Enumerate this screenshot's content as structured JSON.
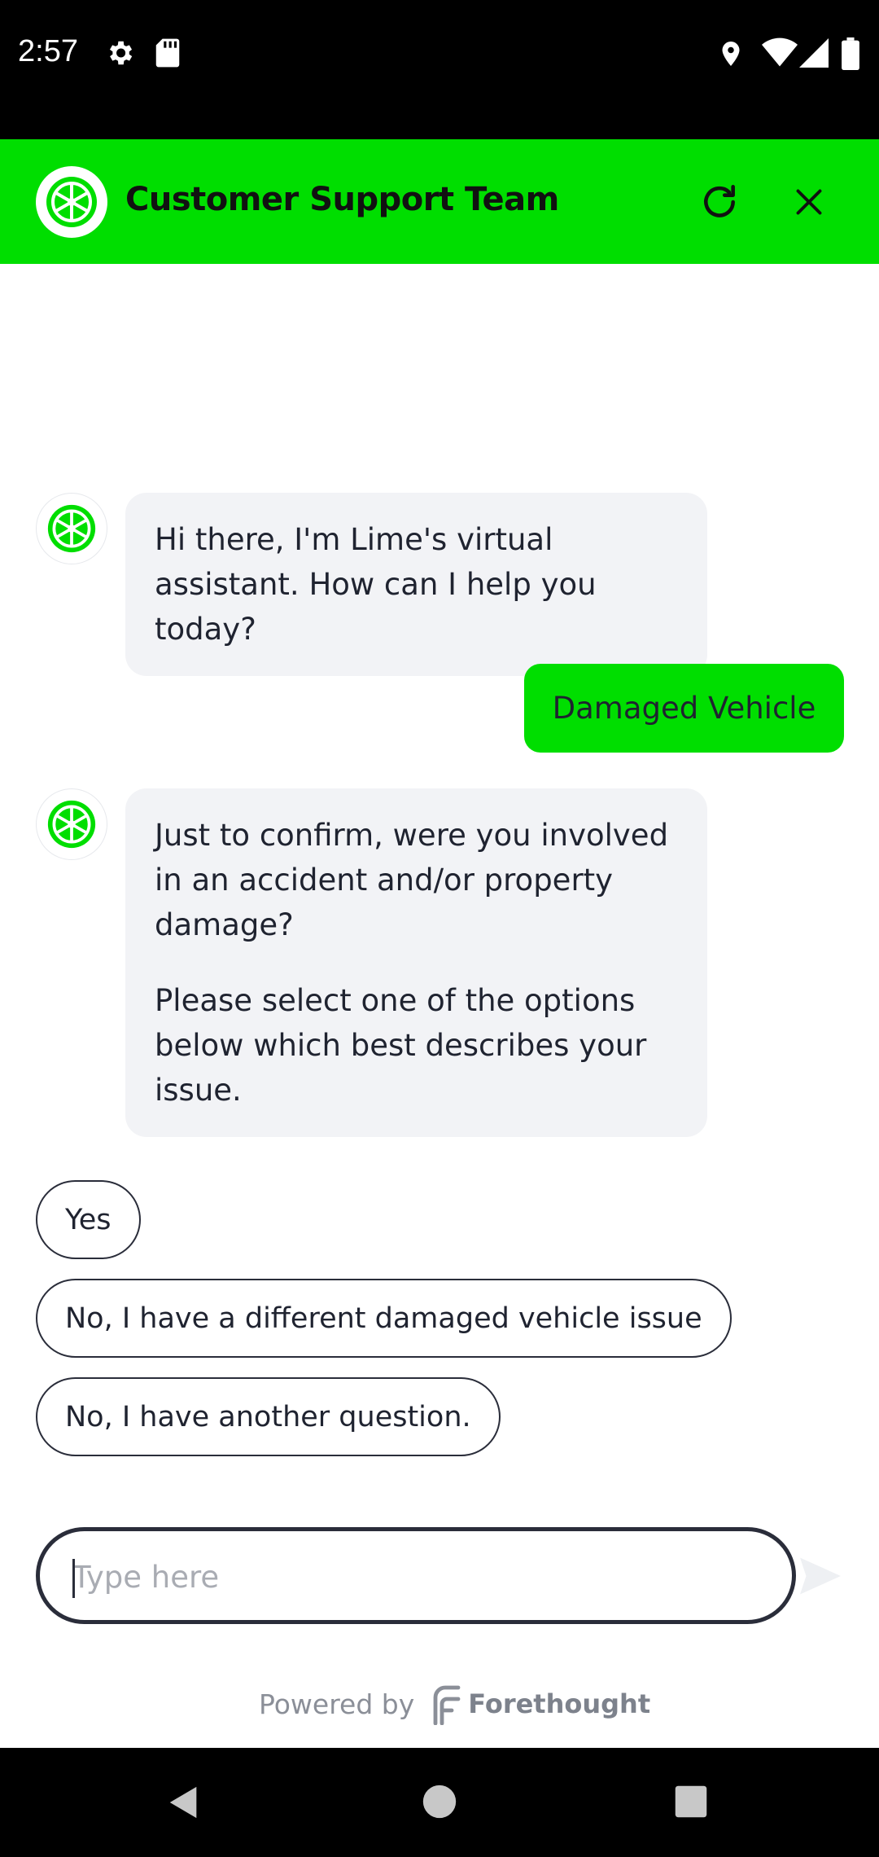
{
  "status_bar": {
    "time": "2:57"
  },
  "header": {
    "title": "Customer Support Team"
  },
  "messages": [
    {
      "from": "bot",
      "paragraphs": [
        "Hi there, I'm Lime's virtual assistant. How can I help you today?"
      ]
    },
    {
      "from": "user",
      "text": "Damaged Vehicle"
    },
    {
      "from": "bot",
      "paragraphs": [
        "Just to confirm, were you involved in an accident and/or property damage?",
        "Please select one of the options below which best describes your issue."
      ]
    }
  ],
  "options": [
    "Yes",
    "No, I have a different damaged vehicle issue",
    "No, I have another question."
  ],
  "composer": {
    "placeholder": "Type here"
  },
  "footer": {
    "powered_by": "Powered by",
    "brand": "Forethought"
  },
  "colors": {
    "brand_green": "#00de00",
    "bubble_gray": "#f2f3f6"
  },
  "icons": [
    "settings-icon",
    "sd-card-icon",
    "location-icon",
    "wifi-icon",
    "signal-icon",
    "battery-icon",
    "lime-logo-icon",
    "refresh-icon",
    "close-icon",
    "send-icon",
    "forethought-logo-icon",
    "back-icon",
    "home-icon",
    "recents-icon"
  ]
}
